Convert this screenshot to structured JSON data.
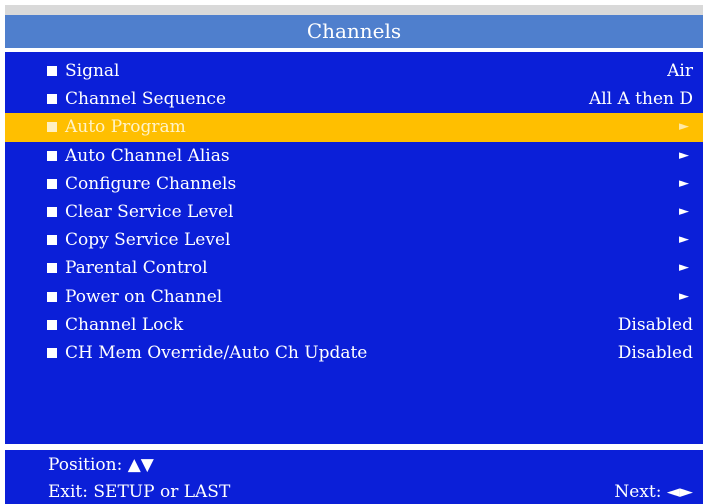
{
  "title": "Channels",
  "menu": {
    "items": [
      {
        "label": "Signal",
        "value": "Air",
        "arrow": "",
        "highlighted": false
      },
      {
        "label": "Channel Sequence",
        "value": "All A then D",
        "arrow": "",
        "highlighted": false
      },
      {
        "label": "Auto Program",
        "value": "",
        "arrow": "►",
        "highlighted": true
      },
      {
        "label": "Auto Channel Alias",
        "value": "",
        "arrow": "►",
        "highlighted": false
      },
      {
        "label": "Configure Channels",
        "value": "",
        "arrow": "►",
        "highlighted": false
      },
      {
        "label": "Clear Service Level",
        "value": "",
        "arrow": "►",
        "highlighted": false
      },
      {
        "label": "Copy Service Level",
        "value": "",
        "arrow": "►",
        "highlighted": false
      },
      {
        "label": "Parental Control",
        "value": "",
        "arrow": "►",
        "highlighted": false
      },
      {
        "label": "Power on Channel",
        "value": "",
        "arrow": "►",
        "highlighted": false
      },
      {
        "label": "Channel Lock",
        "value": "Disabled",
        "arrow": "",
        "highlighted": false
      },
      {
        "label": "CH Mem Override/Auto Ch Update",
        "value": "Disabled",
        "arrow": "",
        "highlighted": false
      }
    ]
  },
  "footer": {
    "position": "Position: ▲▼",
    "exit": "Exit: SETUP or LAST",
    "next": "Next: ◄►"
  },
  "colors": {
    "panel": "#0b1fd8",
    "title_bar": "#4f7fcd",
    "highlight": "#ffbf00"
  }
}
